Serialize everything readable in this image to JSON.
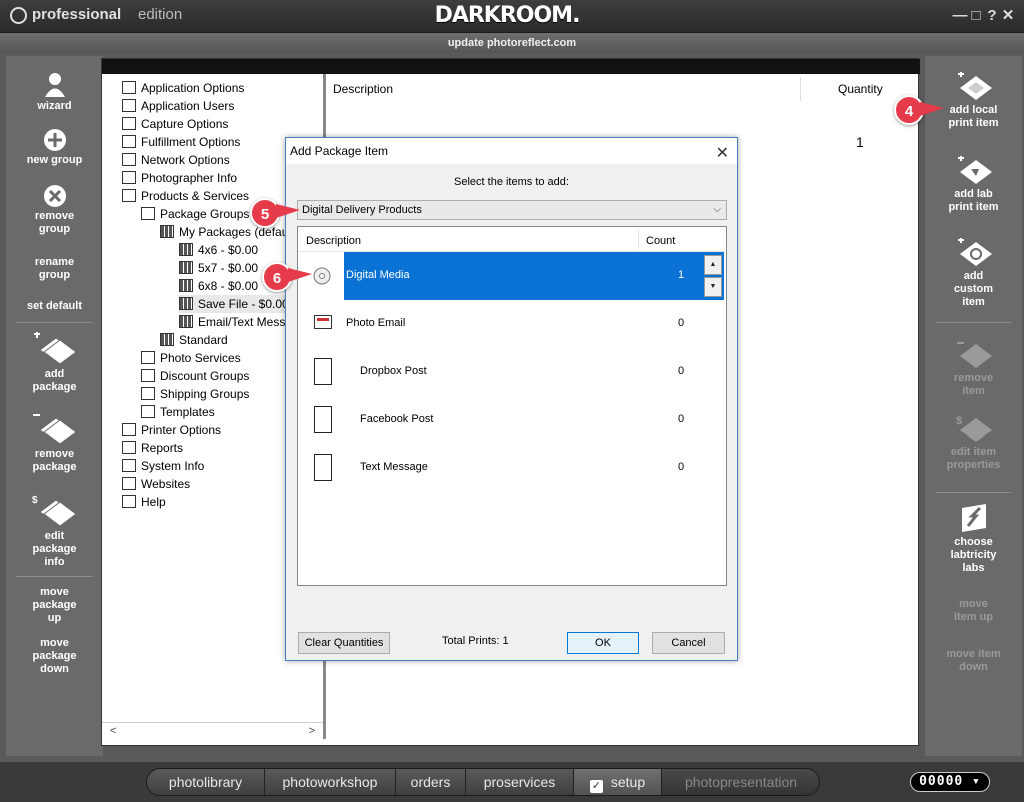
{
  "titlebar": {
    "brand_bold": "professional",
    "brand_light": "edition",
    "logo": "DARKROOM.",
    "controls": [
      "—",
      "□",
      "?",
      "✕"
    ]
  },
  "update_text": "update photoreflect.com",
  "left_tools": [
    {
      "label": "wizard",
      "icon": "wizard-icon"
    },
    {
      "label": "new group",
      "icon": "plus-circle-icon"
    },
    {
      "label": "remove group",
      "icon": "x-circle-icon"
    },
    {
      "label": "rename group"
    },
    {
      "label": "set default"
    },
    {
      "label": "add package",
      "icon": "add-package-icon"
    },
    {
      "label": "remove package",
      "icon": "remove-package-icon"
    },
    {
      "label": "edit package info",
      "icon": "edit-package-icon"
    },
    {
      "label": "move package up"
    },
    {
      "label": "move package down"
    }
  ],
  "right_tools": [
    {
      "label": "add local print item",
      "icon": "add-local-print-icon",
      "enabled": true
    },
    {
      "label": "add lab print item",
      "icon": "add-lab-print-icon",
      "enabled": true
    },
    {
      "label": "add custom item",
      "icon": "add-custom-item-icon",
      "enabled": true
    },
    {
      "label": "remove item",
      "icon": "remove-item-icon",
      "enabled": false
    },
    {
      "label": "edit item properties",
      "icon": "edit-item-icon",
      "enabled": false
    },
    {
      "label": "choose labtricity labs",
      "icon": "labtricity-icon",
      "enabled": true
    },
    {
      "label": "move item up",
      "enabled": false
    },
    {
      "label": "move item down",
      "enabled": false
    }
  ],
  "tree": [
    {
      "label": "Application Options",
      "level": 0
    },
    {
      "label": "Application Users",
      "level": 0
    },
    {
      "label": "Capture Options",
      "level": 0
    },
    {
      "label": "Fulfillment Options",
      "level": 0
    },
    {
      "label": "Network Options",
      "level": 0
    },
    {
      "label": "Photographer Info",
      "level": 0
    },
    {
      "label": "Products & Services",
      "level": 0
    },
    {
      "label": "Package Groups",
      "level": 1
    },
    {
      "label": "My Packages (default)",
      "level": 2
    },
    {
      "label": "4x6 - $0.00",
      "level": 3
    },
    {
      "label": "5x7 - $0.00",
      "level": 3
    },
    {
      "label": "6x8 - $0.00",
      "level": 3
    },
    {
      "label": "Save File - $0.00",
      "level": 3,
      "selected": true
    },
    {
      "label": "Email/Text Message",
      "level": 3
    },
    {
      "label": "Standard",
      "level": 2
    },
    {
      "label": "Photo Services",
      "level": 1
    },
    {
      "label": "Discount Groups",
      "level": 1
    },
    {
      "label": "Shipping Groups",
      "level": 1
    },
    {
      "label": "Templates",
      "level": 1
    },
    {
      "label": "Printer Options",
      "level": 0
    },
    {
      "label": "Reports",
      "level": 0
    },
    {
      "label": "System Info",
      "level": 0
    },
    {
      "label": "Websites",
      "level": 0
    },
    {
      "label": "Help",
      "level": 0
    }
  ],
  "scroll": {
    "left": "<",
    "right": ">"
  },
  "content": {
    "col_description": "Description",
    "col_quantity": "Quantity",
    "quantity_value": "1"
  },
  "dialog": {
    "title": "Add Package Item",
    "close": "✕",
    "prompt": "Select the items to add:",
    "selected_category": "Digital Delivery Products",
    "dropdown_arrow": "⌵",
    "col_description": "Description",
    "col_count": "Count",
    "items": [
      {
        "name": "Digital Media",
        "count": "1",
        "selected": true,
        "icon": "disc-icon"
      },
      {
        "name": "Photo Email",
        "count": "0",
        "icon": "email-icon"
      },
      {
        "name": "Dropbox Post",
        "count": "0",
        "icon": "phone-icon"
      },
      {
        "name": "Facebook Post",
        "count": "0",
        "icon": "phone-icon"
      },
      {
        "name": "Text Message",
        "count": "0",
        "icon": "phone-icon"
      }
    ],
    "spin_up": "▲",
    "spin_down": "▼",
    "clear_label": "Clear Quantities",
    "total_prints": "Total Prints: 1",
    "ok_label": "OK",
    "cancel_label": "Cancel"
  },
  "callouts": [
    "4",
    "5",
    "6"
  ],
  "nav_tabs": [
    {
      "label": "photolibrary"
    },
    {
      "label": "photoworkshop"
    },
    {
      "label": "orders"
    },
    {
      "label": "proservices"
    },
    {
      "label": "setup",
      "active": true
    },
    {
      "label": "photopresentation",
      "dim": true
    }
  ],
  "counter": "00000 ▾"
}
